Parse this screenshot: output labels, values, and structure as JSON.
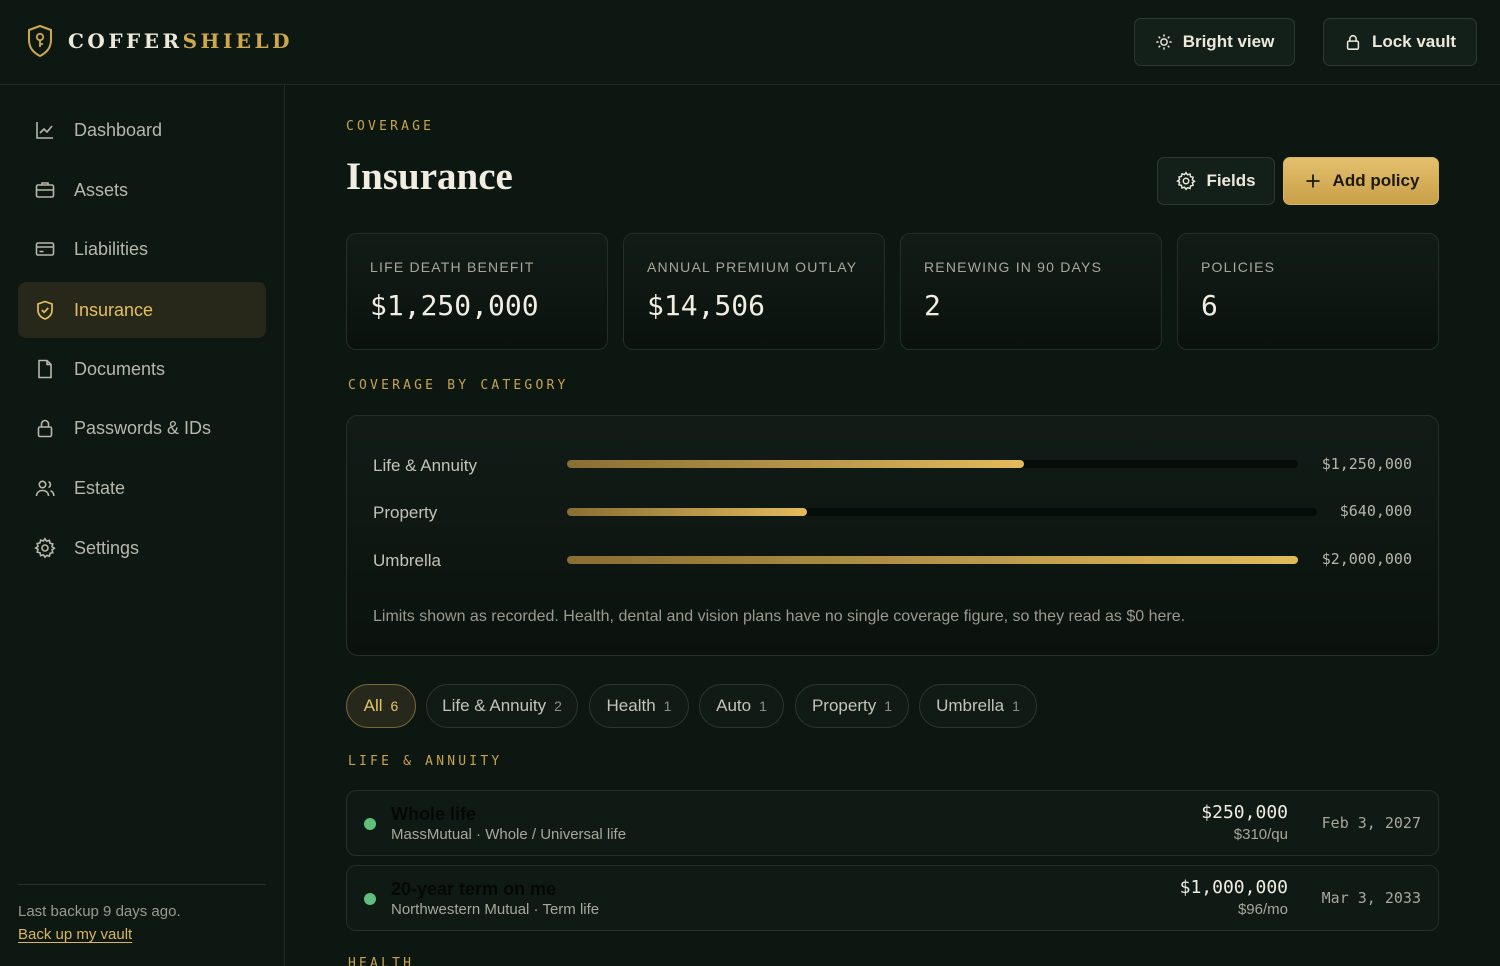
{
  "brand": {
    "part1": "COFFER",
    "part2": "SHIELD"
  },
  "topbar": {
    "bright_label": "Bright view",
    "lock_label": "Lock vault"
  },
  "sidebar": {
    "items": [
      {
        "label": "Dashboard",
        "icon": "chart-line-icon"
      },
      {
        "label": "Assets",
        "icon": "briefcase-icon"
      },
      {
        "label": "Liabilities",
        "icon": "credit-card-icon"
      },
      {
        "label": "Insurance",
        "icon": "shield-check-icon",
        "active": true
      },
      {
        "label": "Documents",
        "icon": "file-icon"
      },
      {
        "label": "Passwords & IDs",
        "icon": "lock-icon"
      },
      {
        "label": "Estate",
        "icon": "users-icon"
      },
      {
        "label": "Settings",
        "icon": "gear-icon"
      }
    ],
    "backup_text": "Last backup 9 days ago.",
    "backup_link": "Back up my vault"
  },
  "page": {
    "eyebrow": "COVERAGE",
    "title": "Insurance",
    "fields_label": "Fields",
    "add_label": "Add policy"
  },
  "stats": [
    {
      "label": "LIFE DEATH BENEFIT",
      "value": "$1,250,000"
    },
    {
      "label": "ANNUAL PREMIUM OUTLAY",
      "value": "$14,506"
    },
    {
      "label": "RENEWING IN 90 DAYS",
      "value": "2"
    },
    {
      "label": "POLICIES",
      "value": "6"
    }
  ],
  "coverage": {
    "heading": "COVERAGE BY CATEGORY",
    "rows": [
      {
        "label": "Life & Annuity",
        "value": "$1,250,000",
        "fraction": 0.625
      },
      {
        "label": "Property",
        "value": "$640,000",
        "fraction": 0.32
      },
      {
        "label": "Umbrella",
        "value": "$2,000,000",
        "fraction": 1.0
      }
    ],
    "note": "Limits shown as recorded. Health, dental and vision plans have no single coverage figure, so they read as $0 here."
  },
  "filters": [
    {
      "label": "All",
      "count": "6",
      "active": true
    },
    {
      "label": "Life & Annuity",
      "count": "2"
    },
    {
      "label": "Health",
      "count": "1"
    },
    {
      "label": "Auto",
      "count": "1"
    },
    {
      "label": "Property",
      "count": "1"
    },
    {
      "label": "Umbrella",
      "count": "1"
    }
  ],
  "groups": {
    "life_heading": "LIFE & ANNUITY",
    "health_heading": "HEALTH"
  },
  "policies": [
    {
      "name": "Whole life",
      "sub": "MassMutual · Whole / Universal life",
      "amount": "$250,000",
      "premium": "$310/qu",
      "date": "Feb 3, 2027",
      "status_color": "#5fbf7c"
    },
    {
      "name": "20-year term on me",
      "sub": "Northwestern Mutual · Term life",
      "amount": "$1,000,000",
      "premium": "$96/mo",
      "date": "Mar 3, 2033",
      "status_color": "#5fbf7c"
    }
  ],
  "colors": {
    "accent": "#cfa84d",
    "background": "#0c1712",
    "status_active": "#5fbf7c"
  }
}
